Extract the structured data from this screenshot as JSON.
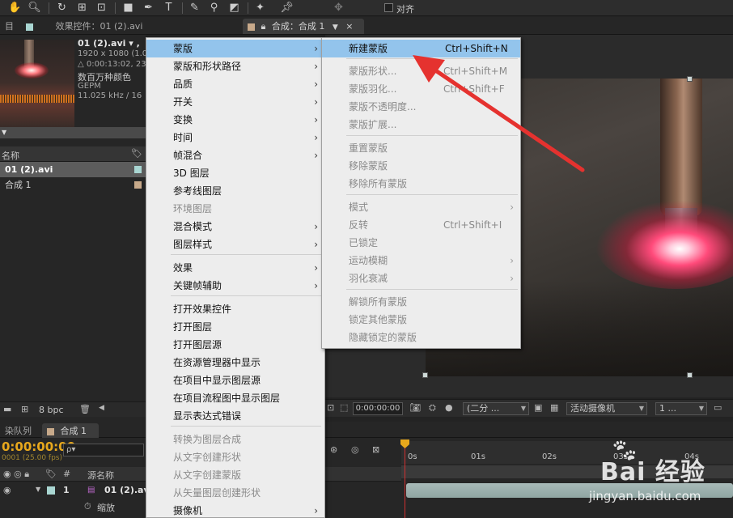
{
  "toolbar": {
    "align_label": "对齐"
  },
  "tabs": {
    "effects_controls": "效果控件：01 (2).avi",
    "composition": "合成：合成 1"
  },
  "project": {
    "file_name": "01 (2).avi ▾ ,",
    "resolution": "1920 x 1080 (1.0",
    "duration": "△ 0:00:13:02, 23",
    "colors": "数百万种颜色",
    "codec": "GEPM",
    "audio": "11.025 kHz / 16",
    "column_name": "名称",
    "items": [
      {
        "label": "01 (2).avi",
        "color": "#a9d6d2",
        "selected": true
      },
      {
        "label": "合成 1",
        "color": "#c7a98a",
        "selected": false
      }
    ],
    "bpc": "8 bpc"
  },
  "viewer": {
    "timecode": "0:00:00:00",
    "resolution_select": "(二分 ...",
    "camera_select": "活动摄像机",
    "views_select": "1 ..."
  },
  "timeline": {
    "tab_render_queue": "染队列",
    "tab_comp": "合成 1",
    "current_time": "0:00:00:00",
    "fps": "0001 (25.00 fps)",
    "search_placeholder": "ρ▾",
    "col_num": "#",
    "col_source_name": "源名称",
    "layer_number": "1",
    "layer_name": "01 (2).avi",
    "layer_color": "#a9d6d2",
    "sub_property": "缩放",
    "ticks": [
      "0s",
      "01s",
      "02s",
      "03s",
      "04s"
    ]
  },
  "context_menu": {
    "items": [
      {
        "label": "蒙版",
        "submenu": true,
        "highlight": true,
        "disabled": false
      },
      {
        "label": "蒙版和形状路径",
        "submenu": true,
        "highlight": false,
        "disabled": false
      },
      {
        "label": "品质",
        "submenu": true,
        "highlight": false,
        "disabled": false
      },
      {
        "label": "开关",
        "submenu": true,
        "highlight": false,
        "disabled": false
      },
      {
        "label": "变换",
        "submenu": true,
        "highlight": false,
        "disabled": false
      },
      {
        "label": "时间",
        "submenu": true,
        "highlight": false,
        "disabled": false
      },
      {
        "label": "帧混合",
        "submenu": true,
        "highlight": false,
        "disabled": false
      },
      {
        "label": "3D 图层",
        "submenu": false,
        "highlight": false,
        "disabled": false
      },
      {
        "label": "参考线图层",
        "submenu": false,
        "highlight": false,
        "disabled": false
      },
      {
        "label": "环境图层",
        "submenu": false,
        "highlight": false,
        "disabled": true
      },
      {
        "label": "混合模式",
        "submenu": true,
        "highlight": false,
        "disabled": false
      },
      {
        "label": "图层样式",
        "submenu": true,
        "highlight": false,
        "disabled": false
      },
      {
        "label": "效果",
        "submenu": true,
        "highlight": false,
        "disabled": false
      },
      {
        "label": "关键帧辅助",
        "submenu": true,
        "highlight": false,
        "disabled": false
      },
      {
        "label": "打开效果控件",
        "submenu": false,
        "highlight": false,
        "disabled": false
      },
      {
        "label": "打开图层",
        "submenu": false,
        "highlight": false,
        "disabled": false
      },
      {
        "label": "打开图层源",
        "submenu": false,
        "highlight": false,
        "disabled": false
      },
      {
        "label": "在资源管理器中显示",
        "submenu": false,
        "highlight": false,
        "disabled": false
      },
      {
        "label": "在项目中显示图层源",
        "submenu": false,
        "highlight": false,
        "disabled": false
      },
      {
        "label": "在项目流程图中显示图层",
        "submenu": false,
        "highlight": false,
        "disabled": false
      },
      {
        "label": "显示表达式错误",
        "submenu": false,
        "highlight": false,
        "disabled": false
      },
      {
        "label": "转换为图层合成",
        "submenu": false,
        "highlight": false,
        "disabled": true
      },
      {
        "label": "从文字创建形状",
        "submenu": false,
        "highlight": false,
        "disabled": true
      },
      {
        "label": "从文字创建蒙版",
        "submenu": false,
        "highlight": false,
        "disabled": true
      },
      {
        "label": "从矢量图层创建形状",
        "submenu": false,
        "highlight": false,
        "disabled": true
      },
      {
        "label": "摄像机",
        "submenu": true,
        "highlight": false,
        "disabled": false
      }
    ]
  },
  "submenu": {
    "items": [
      {
        "label": "新建蒙版",
        "shortcut": "Ctrl+Shift+N",
        "submenu": false,
        "highlight": true,
        "disabled": false
      },
      {
        "label": "蒙版形状...",
        "shortcut": "Ctrl+Shift+M",
        "submenu": false,
        "highlight": false,
        "disabled": true
      },
      {
        "label": "蒙版羽化...",
        "shortcut": "Ctrl+Shift+F",
        "submenu": false,
        "highlight": false,
        "disabled": true
      },
      {
        "label": "蒙版不透明度...",
        "shortcut": "",
        "submenu": false,
        "highlight": false,
        "disabled": true
      },
      {
        "label": "蒙版扩展...",
        "shortcut": "",
        "submenu": false,
        "highlight": false,
        "disabled": true
      },
      {
        "label": "重置蒙版",
        "shortcut": "",
        "submenu": false,
        "highlight": false,
        "disabled": true
      },
      {
        "label": "移除蒙版",
        "shortcut": "",
        "submenu": false,
        "highlight": false,
        "disabled": true
      },
      {
        "label": "移除所有蒙版",
        "shortcut": "",
        "submenu": false,
        "highlight": false,
        "disabled": true
      },
      {
        "label": "模式",
        "shortcut": "",
        "submenu": true,
        "highlight": false,
        "disabled": true
      },
      {
        "label": "反转",
        "shortcut": "Ctrl+Shift+I",
        "submenu": false,
        "highlight": false,
        "disabled": true
      },
      {
        "label": "已锁定",
        "shortcut": "",
        "submenu": false,
        "highlight": false,
        "disabled": true
      },
      {
        "label": "运动模糊",
        "shortcut": "",
        "submenu": true,
        "highlight": false,
        "disabled": true
      },
      {
        "label": "羽化衰减",
        "shortcut": "",
        "submenu": true,
        "highlight": false,
        "disabled": true
      },
      {
        "label": "解锁所有蒙版",
        "shortcut": "",
        "submenu": false,
        "highlight": false,
        "disabled": true
      },
      {
        "label": "锁定其他蒙版",
        "shortcut": "",
        "submenu": false,
        "highlight": false,
        "disabled": true
      },
      {
        "label": "隐藏锁定的蒙版",
        "shortcut": "",
        "submenu": false,
        "highlight": false,
        "disabled": true
      }
    ]
  },
  "watermark": {
    "brand": "Bai 经验",
    "url": "jingyan.baidu.com"
  }
}
